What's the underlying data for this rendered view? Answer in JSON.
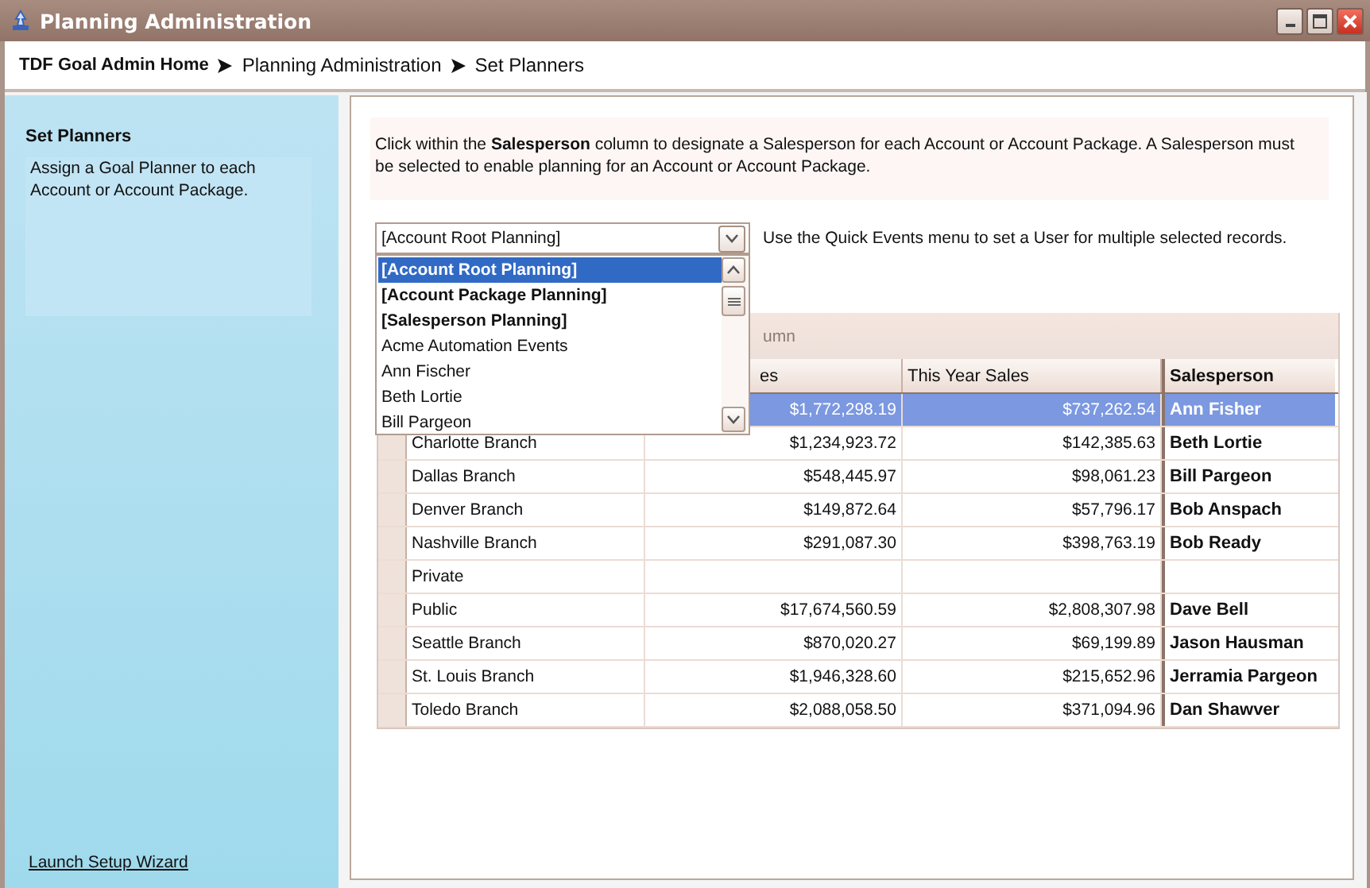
{
  "window": {
    "title": "Planning Administration"
  },
  "breadcrumb": [
    {
      "label": "TDF Goal Admin Home"
    },
    {
      "label": "Planning Administration"
    },
    {
      "label": "Set Planners"
    }
  ],
  "sidebar": {
    "heading": "Set Planners",
    "description": "Assign a Goal Planner to each Account or Account Package.",
    "link": "Launch Setup Wizard"
  },
  "instructions": "Click within the **Salesperson** column to designate a Salesperson for each Account or Account Package.  A Salesperson must be selected to enable planning for an Account or Account Package.",
  "selector": {
    "value": "[Account Root Planning]",
    "hint": "Use the Quick Events menu to set a User for multiple selected records.",
    "expanded": true,
    "options": [
      {
        "label": "[Account Root Planning]",
        "kind": "group",
        "selected": true
      },
      {
        "label": "[Account Package Planning]",
        "kind": "group",
        "selected": false
      },
      {
        "label": "[Salesperson Planning]",
        "kind": "group",
        "selected": false
      },
      {
        "label": "Acme Automation Events",
        "kind": "user",
        "selected": false
      },
      {
        "label": "Ann Fischer",
        "kind": "user",
        "selected": false
      },
      {
        "label": "Beth Lortie",
        "kind": "user",
        "selected": false
      },
      {
        "label": "Bill Pargeon",
        "kind": "user",
        "selected": false
      }
    ]
  },
  "grid": {
    "group_panel": "umn",
    "columns": [
      {
        "label": "es"
      },
      {
        "label": "This Year Sales"
      },
      {
        "label": "Salesperson"
      }
    ],
    "rows": [
      {
        "last_year": "$1,772,298.19",
        "this_year": "$737,262.54",
        "salesperson": "Ann Fisher",
        "selected": true
      },
      {
        "account": "Charlotte Branch",
        "last_year": "$1,234,923.72",
        "this_year": "$142,385.63",
        "salesperson": "Beth Lortie",
        "selected": false
      },
      {
        "account": "Dallas Branch",
        "last_year": "$548,445.97",
        "this_year": "$98,061.23",
        "salesperson": "Bill Pargeon",
        "selected": false
      },
      {
        "account": "Denver Branch",
        "last_year": "$149,872.64",
        "this_year": "$57,796.17",
        "salesperson": "Bob Anspach",
        "selected": false
      },
      {
        "account": "Nashville Branch",
        "last_year": "$291,087.30",
        "this_year": "$398,763.19",
        "salesperson": "Bob Ready",
        "selected": false
      },
      {
        "account": "Private",
        "selected": false
      },
      {
        "account": "Public",
        "last_year": "$17,674,560.59",
        "this_year": "$2,808,307.98",
        "salesperson": "Dave Bell",
        "selected": false
      },
      {
        "account": "Seattle Branch",
        "last_year": "$870,020.27",
        "this_year": "$69,199.89",
        "salesperson": "Jason Hausman",
        "selected": false
      },
      {
        "account": "St. Louis Branch",
        "last_year": "$1,946,328.60",
        "this_year": "$215,652.96",
        "salesperson": "Jerramia Pargeon",
        "selected": false
      },
      {
        "account": "Toledo Branch",
        "last_year": "$2,088,058.50",
        "this_year": "$371,094.96",
        "salesperson": "Dan Shawver",
        "selected": false
      }
    ]
  }
}
